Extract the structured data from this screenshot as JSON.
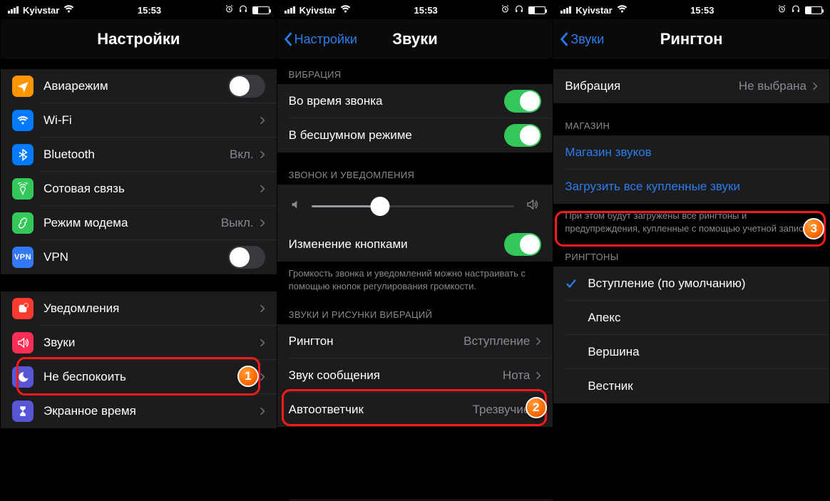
{
  "statusbar": {
    "carrier": "Kyivstar",
    "time": "15:53"
  },
  "screen1": {
    "title": "Настройки",
    "rows": {
      "airplane": "Авиарежим",
      "wifi": "Wi-Fi",
      "wifi_value": "",
      "bluetooth": "Bluetooth",
      "bluetooth_value": "Вкл.",
      "cellular": "Сотовая связь",
      "hotspot": "Режим модема",
      "hotspot_value": "Выкл.",
      "vpn": "VPN"
    },
    "rows2": {
      "notifications": "Уведомления",
      "sounds": "Звуки",
      "dnd": "Не беспокоить",
      "screentime": "Экранное время"
    }
  },
  "screen2": {
    "back": "Настройки",
    "title": "Звуки",
    "vibration_hdr": "ВИБРАЦИЯ",
    "vib_ring": "Во время звонка",
    "vib_silent": "В бесшумном режиме",
    "ringer_hdr": "ЗВОНОК И УВЕДОМЛЕНИЯ",
    "change_buttons": "Изменение кнопками",
    "ringer_ftr": "Громкость звонка и уведомлений можно настраивать с помощью кнопок регулирования громкости.",
    "patterns_hdr": "ЗВУКИ И РИСУНКИ ВИБРАЦИЙ",
    "ringtone": "Рингтон",
    "ringtone_value": "Вступление",
    "texttone": "Звук сообщения",
    "texttone_value": "Нота",
    "answering": "Автоответчик",
    "answering_value": "Трезвучие",
    "slider_pct": 34
  },
  "screen3": {
    "back": "Звуки",
    "title": "Рингтон",
    "vibration": "Вибрация",
    "vibration_value": "Не выбрана",
    "store_hdr": "МАГАЗИН",
    "store_link": "Магазин звуков",
    "download_link": "Загрузить все купленные звуки",
    "store_ftr": "При этом будут загружены все рингтоны и предупреждения, купленные с помощью учетной записи",
    "ringtones_hdr": "РИНГТОНЫ",
    "tones": [
      "Вступление (по умолчанию)",
      "Апекс",
      "Вершина",
      "Вестник"
    ]
  },
  "badges": {
    "one": "1",
    "two": "2",
    "three": "3"
  }
}
